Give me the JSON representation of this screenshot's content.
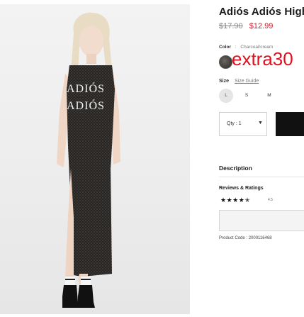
{
  "product": {
    "title": "Adiós Adiós High",
    "price_original": "$17.90",
    "price_sale": "$12.99",
    "color_label": "Color",
    "color_separator": ":",
    "color_value": "Charcoal/cream",
    "promo_code": "extra30",
    "size_label": "Size",
    "size_guide": "Size Guide",
    "sizes": [
      "L",
      "S",
      "M"
    ],
    "selected_size": "L",
    "qty_text": "Qty : 1",
    "description_label": "Description",
    "reviews_label": "Reviews & Ratings",
    "stars": "★★★★✭",
    "rating_value": "4.5",
    "product_code": "Product Code : 2000116468",
    "shirt_print_line1": "ADIÓS",
    "shirt_print_line2": "ADIÓS"
  },
  "colors": {
    "sale_price": "#d11a2a",
    "promo": "#e0111f",
    "dress": "#3c3936",
    "button": "#111111"
  }
}
